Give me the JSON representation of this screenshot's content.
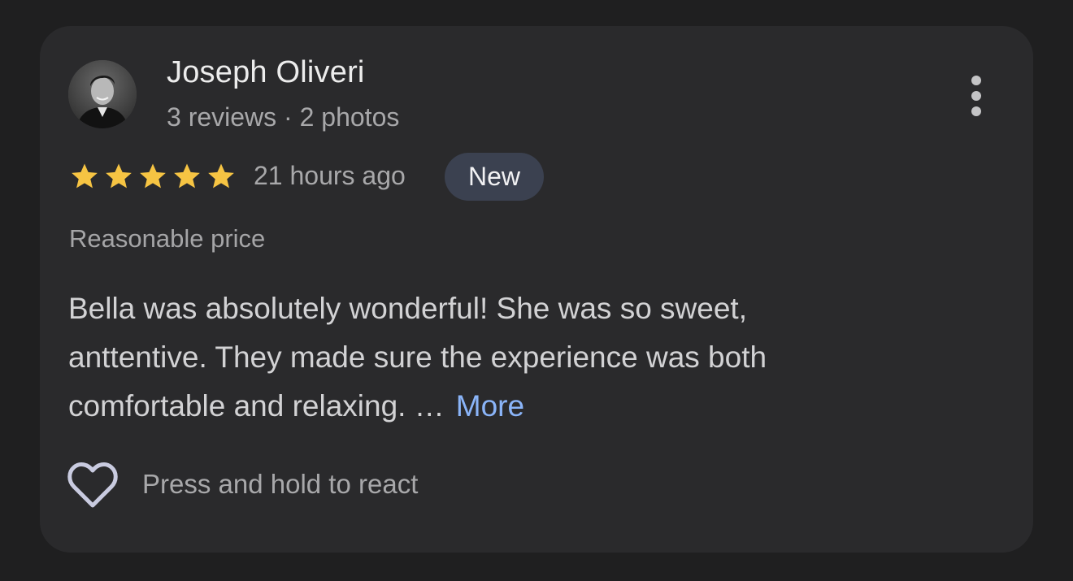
{
  "review": {
    "reviewer": {
      "name": "Joseph Oliveri",
      "stats": "3 reviews · 2 photos",
      "avatar_icon": "profile-photo"
    },
    "menu_icon": "more-vert-icon",
    "rating": {
      "value": 5,
      "max": 5,
      "star_color": "#f6c443"
    },
    "time_ago": "21 hours ago",
    "badge": "New",
    "tag": "Reasonable price",
    "text_lines": [
      "Bella was absolutely wonderful! She was so sweet,",
      "anttentive. They made sure the experience was both",
      "comfortable and relaxing. …"
    ],
    "more_label": "More",
    "react": {
      "icon": "heart-outline-icon",
      "label": "Press and hold to react"
    }
  },
  "colors": {
    "background": "#1f1f20",
    "card": "#2a2a2c",
    "link": "#8ab4f8",
    "badge_bg": "#3b4150"
  }
}
